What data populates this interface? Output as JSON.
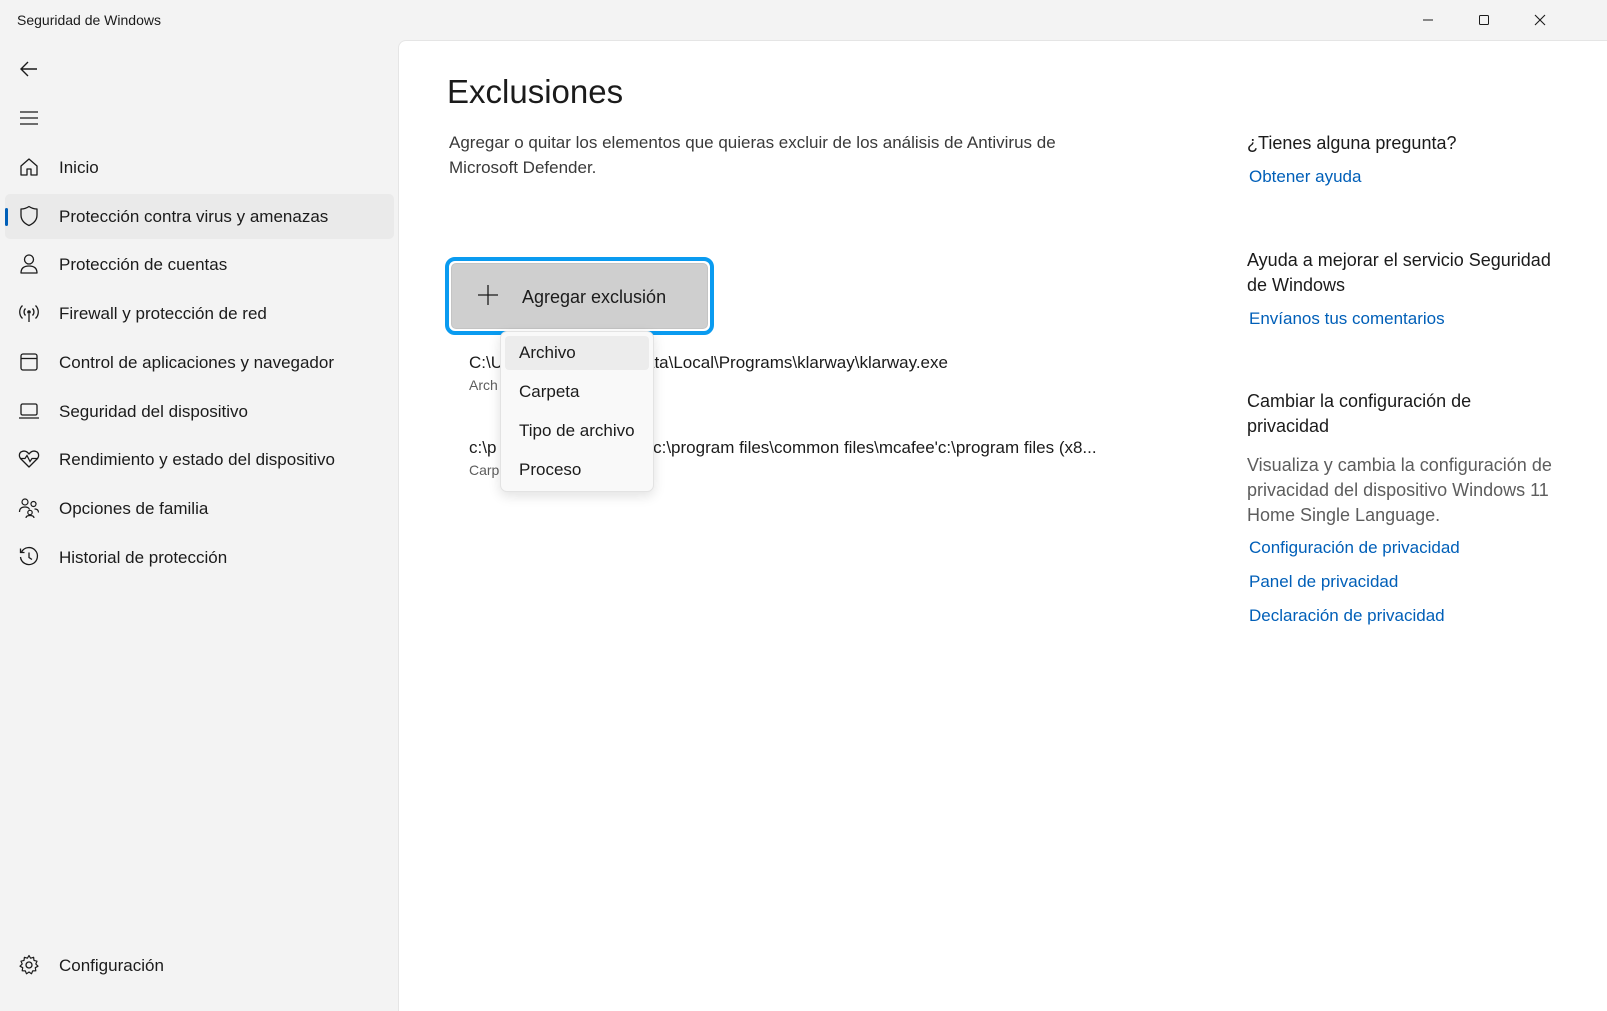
{
  "window": {
    "title": "Seguridad de Windows",
    "controls": [
      "minimize",
      "maximize",
      "close"
    ]
  },
  "sidebar": {
    "items": [
      {
        "label": "Inicio",
        "icon": "home-icon"
      },
      {
        "label": "Protección contra virus y amenazas",
        "icon": "shield-icon",
        "selected": true
      },
      {
        "label": "Protección de cuentas",
        "icon": "person-icon"
      },
      {
        "label": "Firewall y protección de red",
        "icon": "wireless-icon"
      },
      {
        "label": "Control de aplicaciones y navegador",
        "icon": "browser-window-icon"
      },
      {
        "label": "Seguridad del dispositivo",
        "icon": "laptop-icon"
      },
      {
        "label": "Rendimiento y estado del dispositivo",
        "icon": "heart-pulse-icon"
      },
      {
        "label": "Opciones de familia",
        "icon": "family-icon"
      },
      {
        "label": "Historial de protección",
        "icon": "history-icon"
      }
    ],
    "settings_label": "Configuración"
  },
  "main": {
    "title": "Exclusiones",
    "description": "Agregar o quitar los elementos que quieras excluir de los análisis de Antivirus de Microsoft Defender.",
    "add_button_label": "Agregar exclusión",
    "exclusions": [
      {
        "path_left": "C:\\U",
        "path_right": "ata\\Local\\Programs\\klarway\\klarway.exe",
        "type": "Arch"
      },
      {
        "path_left": "c:\\p",
        "path_right": "e'c:\\program files\\common files\\mcafee'c:\\program files (x8...",
        "type": "Carp"
      }
    ],
    "dropdown": {
      "options": [
        "Archivo",
        "Carpeta",
        "Tipo de archivo",
        "Proceso"
      ],
      "hovered": "Archivo"
    }
  },
  "right_panel": {
    "question_heading": "¿Tienes alguna pregunta?",
    "help_link": "Obtener ayuda",
    "improve_heading": "Ayuda a mejorar el servicio Seguridad de Windows",
    "feedback_link": "Envíanos tus comentarios",
    "privacy_heading": "Cambiar la configuración de privacidad",
    "privacy_text": "Visualiza y cambia la configuración de privacidad del dispositivo Windows 11 Home Single Language.",
    "privacy_links": [
      "Configuración de privacidad",
      "Panel de privacidad",
      "Declaración de privacidad"
    ]
  },
  "colors": {
    "accent": "#005fb8",
    "focus_ring": "#0a9bf0",
    "sidebar_bg": "#f3f3f3",
    "content_bg": "#ffffff"
  }
}
